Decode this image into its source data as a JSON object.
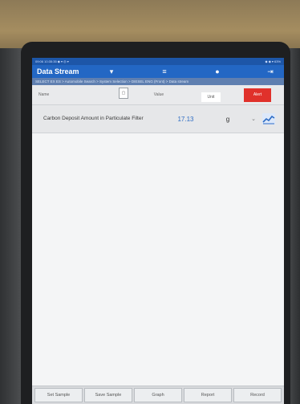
{
  "header": {
    "status_left": "09:06 10:35:35 ◆ ▾ ◎ ▾",
    "status_right": "◆ ◆ ▾ 63%",
    "title": "Data Stream",
    "breadcrumb": "SELECT EX ES > Automobile Search > System Selection > DIESEL ENG (Front) > Data stream"
  },
  "columns": {
    "name": "Name",
    "value": "Value",
    "unit": "Unit",
    "alert": "Alert"
  },
  "rows": [
    {
      "name": "Carbon Deposit Amount in Particulate Filter",
      "value": "17.13",
      "unit": "g"
    }
  ],
  "toolbar": {
    "buttons": [
      "Set Sample",
      "Save Sample",
      "Graph",
      "Report",
      "Record"
    ]
  },
  "colors": {
    "app_bar": "#2367c4",
    "alert": "#e0312b",
    "value_text": "#2f6dc4"
  }
}
